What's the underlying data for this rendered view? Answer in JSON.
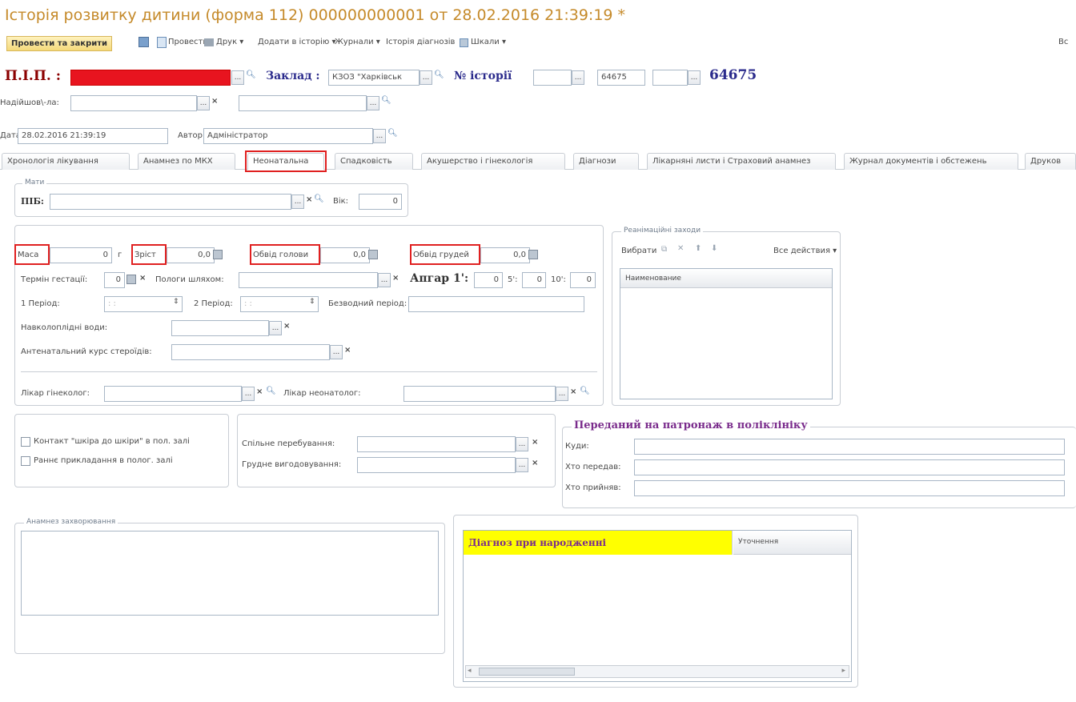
{
  "window": {
    "title": "Історія розвитку дитини (форма 112) 000000000001 от 28.02.2016 21:39:19 *"
  },
  "toolbar": {
    "post_close": "Провести та закрити",
    "post": "Провести",
    "print": "Друк",
    "add_history": "Додати в історію",
    "journals": "Журнали",
    "diag_history": "Історія діагнозів",
    "scales": "Шкали",
    "truncated_right": "Вс"
  },
  "header": {
    "pib_label": "П.І.П. :",
    "zaklad_label": "Заклад :",
    "zaklad_value": "КЗОЗ \"Харківськ",
    "history_label": "№ історії",
    "history_code": "64675",
    "history_number": "64675",
    "nadiyshov_label": "Надійшов\\-ла:",
    "date_label": "Дата:",
    "date_value": "28.02.2016 21:39:19",
    "author_label": "Автор:",
    "author_value": "Адміністратор"
  },
  "tabs": [
    "Хронологія лікування",
    "Анамнез по МКХ",
    "Неонатальна",
    "Спадковість",
    "Акушерство і гінекологія",
    "Діагнози",
    "Лікарняні листи і Страховий анамнез",
    "Журнал документів і обстежень",
    "Друков"
  ],
  "mother": {
    "legend": "Мати",
    "pib_label": "ПІБ:",
    "age_label": "Вік:",
    "age_value": "0"
  },
  "measurements": {
    "mass_label": "Маса",
    "mass_value": "0",
    "mass_unit": "г",
    "height_label": "Зріст",
    "height_value": "0,0",
    "head_label": "Обвід голови",
    "head_value": "0,0",
    "chest_label": "Обвід грудей",
    "chest_value": "0,0",
    "gestation_label": "Термін гестації:",
    "gestation_value": "0",
    "delivery_label": "Пологи шляхом:",
    "apgar_label": "Апгар 1':",
    "apgar_1": "0",
    "apgar_5_label": "5':",
    "apgar_5": "0",
    "apgar_10_label": "10':",
    "apgar_10": "0",
    "period1_label": "1 Період:",
    "period1_value": ": :",
    "period2_label": "2 Період:",
    "period2_value": ": :",
    "waterless_label": "Безводний період:",
    "amniotic_label": "Навколоплідні води:",
    "steroids_label": "Антенатальний курс стероїдів:",
    "gynecologist_label": "Лікар гінеколог:",
    "neonatologist_label": "Лікар неонатолог:"
  },
  "resuscitation": {
    "legend": "Реанімаційні заходи",
    "select_label": "Вибрати",
    "all_actions": "Все действия",
    "column": "Наименование"
  },
  "contacts": {
    "skin_contact": "Контакт \"шкіра до шкіри\" в пол. залі",
    "early_attach": "Раннє прикладання в полог. залі",
    "joint_stay_label": "Спільне перебування:",
    "breastfeeding_label": "Грудне вигодовування:"
  },
  "patronage": {
    "title": "Переданий на патронаж в поліклініку",
    "where_label": "Куди:",
    "who_passed_label": "Хто передав:",
    "who_received_label": "Хто прийняв:"
  },
  "anamnesis": {
    "legend": "Анамнез захворювання"
  },
  "diagnosis_table": {
    "header_main": "Діагноз при народженні",
    "header_clarify": "Уточнення"
  },
  "colors": {
    "title": "#c58a2a",
    "highlight_red": "#e02020",
    "diag_header_bg": "#ffff00",
    "patronage_title": "#7a2c8c"
  }
}
